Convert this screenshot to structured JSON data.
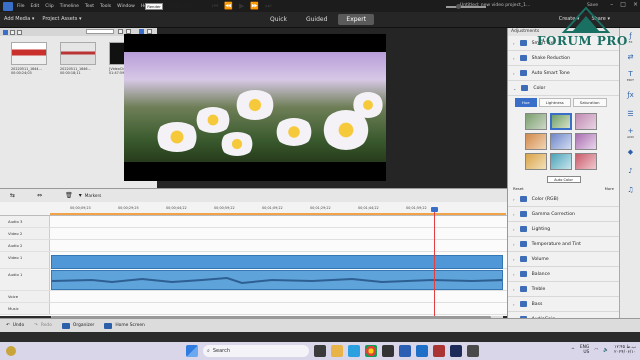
{
  "window": {
    "title": "Untitled: new video project_1...",
    "menu": [
      "File",
      "Edit",
      "Clip",
      "Timeline",
      "Text",
      "Tools",
      "Window",
      "Help"
    ],
    "save_label": "Save"
  },
  "toolbar": {
    "add_media": "Add Media",
    "project_assets": "Project Assets",
    "modes": [
      "Quick",
      "Guided",
      "Expert"
    ],
    "active_mode": "Expert",
    "create": "Create",
    "share": "Share"
  },
  "assets": [
    {
      "name": "20220511_1644...",
      "duration": "00:00:24;03",
      "color": "#c9302c"
    },
    {
      "name": "20220511_1646...",
      "duration": "00:00:18;11",
      "color": "#d9d9d9"
    },
    {
      "name": "[VideoClub.Co...]",
      "duration": "01:47:59;03",
      "color": "#111111"
    }
  ],
  "right_panel": {
    "header": "Adjustments",
    "effects_top": [
      "Smart Fix",
      "Shake Reduction",
      "Auto Smart Tone"
    ],
    "color_section": "Color",
    "color_tabs": [
      "Hue",
      "Lightness",
      "Saturation"
    ],
    "active_color_tab": "Hue",
    "auto_color": "Auto Color",
    "reset": "Reset",
    "more": "More",
    "effects_bottom": [
      "Color (RGB)",
      "Gamma Correction",
      "Lighting",
      "Temperature and Tint",
      "Volume",
      "Balance",
      "Treble",
      "Bass",
      "AudioGain"
    ]
  },
  "strip_icons": [
    {
      "icon": "fx-icon",
      "label": "FX"
    },
    {
      "icon": "transition-icon",
      "label": ""
    },
    {
      "icon": "text-icon",
      "label": "EDIT"
    },
    {
      "icon": "fx-effects-icon",
      "label": ""
    },
    {
      "icon": "adjust-icon",
      "label": ""
    },
    {
      "icon": "add-icon",
      "label": "ADD"
    },
    {
      "icon": "graphics-icon",
      "label": ""
    },
    {
      "icon": "music-icon",
      "label": ""
    },
    {
      "icon": "audio-icon",
      "label": ""
    }
  ],
  "timeline": {
    "markers": "Markers",
    "render": "Render",
    "timecode": "00;01;07;19",
    "ruler": [
      "00;00;09;23",
      "00;00;29;25",
      "00;00;44;22",
      "00;00;59;22",
      "00;01;09;22",
      "00;01;29;22",
      "00;01;44;22",
      "00;01;59;22"
    ],
    "tracks": [
      "Audio 3",
      "Video 2",
      "Audio 2",
      "Video 1",
      "Audio 1",
      "Voice",
      "Music"
    ],
    "playhead_fraction": 0.83
  },
  "bottom": {
    "undo": "Undo",
    "redo": "Redo",
    "organizer": "Organizer",
    "home_screen": "Home Screen"
  },
  "watermark": "FORUM PRO",
  "taskbar": {
    "search": "Search",
    "lang": "ENG",
    "region": "US",
    "time": "۱۲:۴۵ ب.ظ",
    "date": "۲۰۲۴/۰۶/۱۰"
  }
}
